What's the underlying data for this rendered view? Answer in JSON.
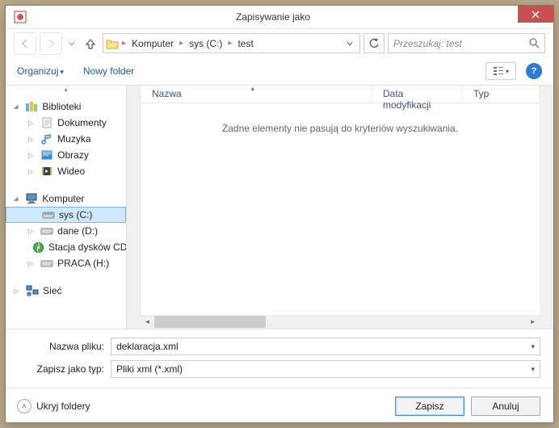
{
  "window": {
    "title": "Zapisywanie jako"
  },
  "nav": {
    "crumbs": [
      "Komputer",
      "sys (C:)",
      "test"
    ],
    "search_placeholder": "Przeszukaj: test"
  },
  "toolbar": {
    "organize": "Organizuj",
    "new_folder": "Nowy folder"
  },
  "tree": {
    "libraries": "Biblioteki",
    "documents": "Dokumenty",
    "music": "Muzyka",
    "pictures": "Obrazy",
    "videos": "Wideo",
    "computer": "Komputer",
    "drive_c": "sys (C:)",
    "drive_d": "dane (D:)",
    "drive_e": "Stacja dysków CD",
    "drive_h": "PRACA (H:)",
    "network": "Sieć"
  },
  "columns": {
    "name": "Nazwa",
    "date": "Data modyfikacji",
    "type": "Typ"
  },
  "filelist": {
    "empty": "Żadne elementy nie pasują do kryteriów wyszukiwania."
  },
  "fields": {
    "filename_label": "Nazwa pliku:",
    "filename_value": "deklaracja.xml",
    "filetype_label": "Zapisz jako typ:",
    "filetype_value": "Pliki xml (*.xml)"
  },
  "footer": {
    "hide_folders": "Ukryj foldery",
    "save": "Zapisz",
    "cancel": "Anuluj"
  }
}
